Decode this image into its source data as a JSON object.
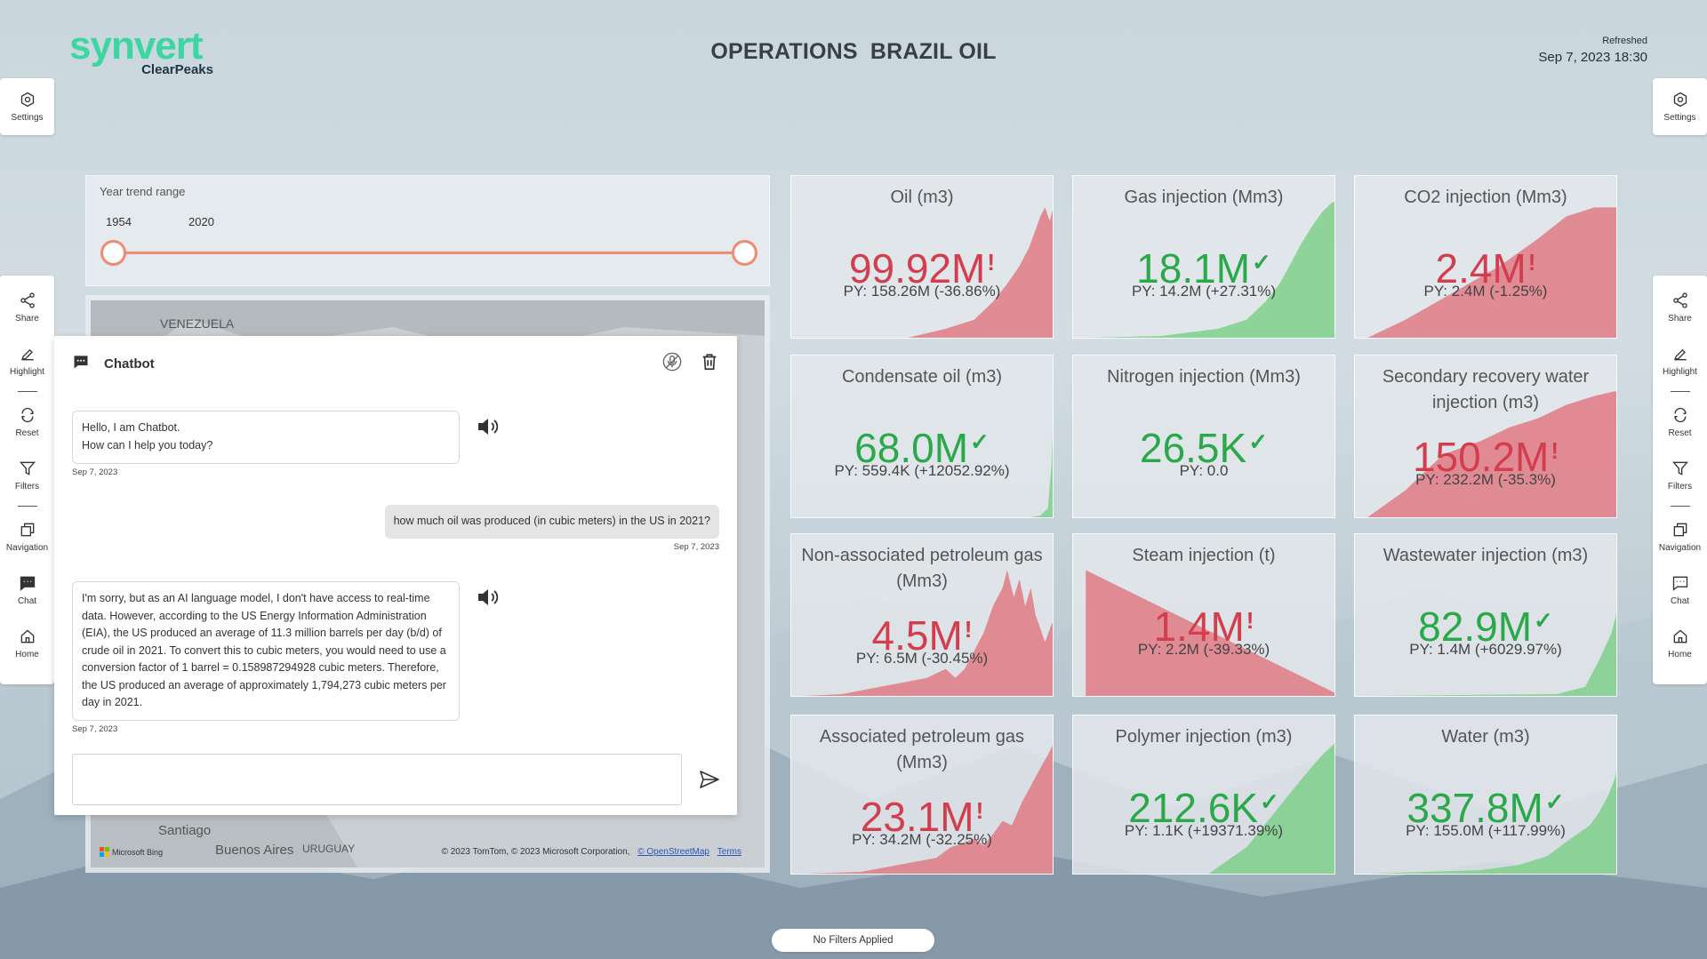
{
  "header": {
    "logo_main": "synvert",
    "logo_sub": "ClearPeaks",
    "title_part1": "OPERATIONS",
    "title_part2": "BRAZIL OIL",
    "refresh_label": "Refreshed",
    "refresh_date": "Sep 7, 2023 18:30"
  },
  "left_rail": {
    "settings": "Settings",
    "items": [
      "Share",
      "Highlight",
      "Reset",
      "Filters",
      "Navigation",
      "Chat",
      "Home"
    ]
  },
  "right_rail": {
    "settings": "Settings",
    "items": [
      "Share",
      "Highlight",
      "Reset",
      "Filters",
      "Navigation",
      "Chat",
      "Home"
    ]
  },
  "slider": {
    "title": "Year trend range",
    "min_value": "1954",
    "max_value": "2020"
  },
  "map": {
    "labels": [
      "VENEZUELA",
      "Santiago",
      "Buenos Aires",
      "URUGUAY"
    ],
    "bing": "Microsoft Bing",
    "attribution": "© 2023 TomTom, © 2023 Microsoft Corporation,",
    "osm_link": "© OpenStreetMap",
    "terms_link": "Terms"
  },
  "tiles": [
    {
      "title": "Oil (m3)",
      "value": "99.92M",
      "mark": "!",
      "py": "PY: 158.26M (-36.86%)",
      "status": "bad"
    },
    {
      "title": "Gas injection (Mm3)",
      "value": "18.1M",
      "mark": "✓",
      "py": "PY: 14.2M (+27.31%)",
      "status": "good"
    },
    {
      "title": "CO2 injection (Mm3)",
      "value": "2.4M",
      "mark": "!",
      "py": "PY: 2.4M (-1.25%)",
      "status": "bad"
    },
    {
      "title": "Condensate oil (m3)",
      "value": "68.0M",
      "mark": "✓",
      "py": "PY: 559.4K (+12052.92%)",
      "status": "good"
    },
    {
      "title": "Nitrogen injection (Mm3)",
      "value": "26.5K",
      "mark": "✓",
      "py": "PY: 0.0",
      "status": "good"
    },
    {
      "title": "Secondary recovery water injection (m3)",
      "value": "150.2M",
      "mark": "!",
      "py": "PY: 232.2M (-35.3%)",
      "status": "bad"
    },
    {
      "title": "Non-associated petroleum gas (Mm3)",
      "value": "4.5M",
      "mark": "!",
      "py": "PY: 6.5M (-30.45%)",
      "status": "bad"
    },
    {
      "title": "Steam injection (t)",
      "value": "1.4M",
      "mark": "!",
      "py": "PY: 2.2M (-39.33%)",
      "status": "bad"
    },
    {
      "title": "Wastewater injection (m3)",
      "value": "82.9M",
      "mark": "✓",
      "py": "PY: 1.4M (+6029.97%)",
      "status": "good"
    },
    {
      "title": "Associated petroleum gas (Mm3)",
      "value": "23.1M",
      "mark": "!",
      "py": "PY: 34.2M (-32.25%)",
      "status": "bad"
    },
    {
      "title": "Polymer injection (m3)",
      "value": "212.6K",
      "mark": "✓",
      "py": "PY: 1.1K (+19371.39%)",
      "status": "good"
    },
    {
      "title": "Water (m3)",
      "value": "337.8M",
      "mark": "✓",
      "py": "PY: 155.0M (+117.99%)",
      "status": "good"
    }
  ],
  "chat": {
    "title": "Chatbot",
    "messages": [
      {
        "role": "bot",
        "text_lines": [
          "Hello, I am Chatbot.",
          "How can I help you today?"
        ],
        "date": "Sep 7, 2023"
      },
      {
        "role": "user",
        "text": "how much oil was produced (in cubic meters) in the US in 2021?",
        "date": "Sep 7, 2023"
      },
      {
        "role": "bot",
        "text": "I'm sorry, but as an AI language model, I don't have access to real-time data. However, according to the US Energy Information Administration (EIA), the US produced an average of 11.3 million barrels per day (b/d) of crude oil in 2021. To convert this to cubic meters, you would need to use a conversion factor of 1 barrel = 0.158987294928 cubic meters. Therefore, the US produced an average of approximately 1,794,273 cubic meters per day in 2021.",
        "date": "Sep 7, 2023"
      }
    ],
    "input_value": ""
  },
  "footer": {
    "filters_label": "No Filters Applied"
  },
  "colors": {
    "bad": "#d33e4e",
    "good": "#2aa84a",
    "bad_fill": "#e07a85",
    "good_fill": "#7fcf8a",
    "brand": "#3ed6a0",
    "slider": "#f08a72"
  }
}
